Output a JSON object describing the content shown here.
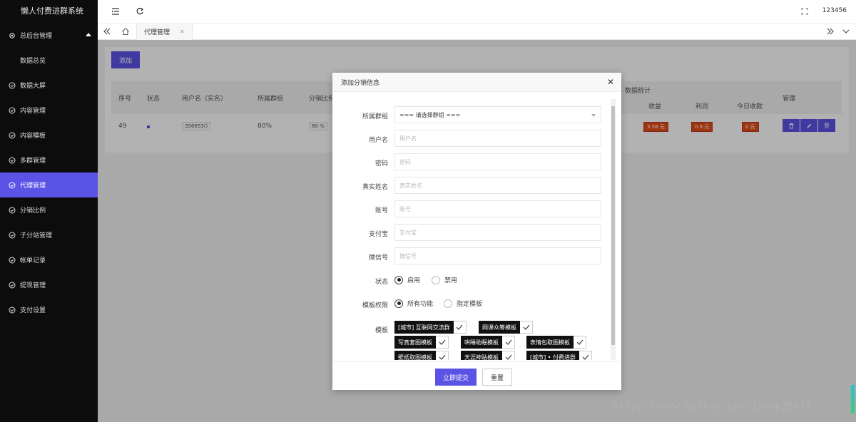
{
  "app": {
    "title": "懒人付费进群系统",
    "user": "123456"
  },
  "sidebar": {
    "items": [
      {
        "label": "总后台管理",
        "expanded": true
      },
      {
        "label": "数据总览",
        "sub": true
      },
      {
        "label": "数据大屏"
      },
      {
        "label": "内容管理"
      },
      {
        "label": "内容模板"
      },
      {
        "label": "多群管理"
      },
      {
        "label": "代理管理",
        "active": true
      },
      {
        "label": "分销比例"
      },
      {
        "label": "子分站管理"
      },
      {
        "label": "帐单记录"
      },
      {
        "label": "提现管理"
      },
      {
        "label": "支付设置"
      }
    ]
  },
  "tabs": {
    "active": "代理管理"
  },
  "page": {
    "add_label": "添加",
    "table": {
      "headers": {
        "index": "序号",
        "status": "状态",
        "username": "用户名（实名）",
        "group": "所属群组",
        "ratio": "分销比例",
        "stats": "数据统计",
        "income": "收益",
        "profit": "利润",
        "today": "今日收款",
        "manage": "管理"
      },
      "row": {
        "index": "49",
        "username": "356653()",
        "group": "80%",
        "ratio": "80 %",
        "income": "3.58 元",
        "profit": "0.9 元",
        "today": "0 元"
      },
      "ops": [
        "删",
        "编",
        "登"
      ]
    }
  },
  "modal": {
    "title": "添加分销信息",
    "fields": {
      "group": {
        "label": "所属群组",
        "value": "=== 请选择群组 ==="
      },
      "username": {
        "label": "用户名",
        "placeholder": "用户名"
      },
      "password": {
        "label": "密码",
        "placeholder": "密码"
      },
      "realname": {
        "label": "真实姓名",
        "placeholder": "真实姓名"
      },
      "account": {
        "label": "账号",
        "placeholder": "账号"
      },
      "alipay": {
        "label": "支付宝",
        "placeholder": "支付宝"
      },
      "wechat": {
        "label": "微信号",
        "placeholder": "微信号"
      }
    },
    "status": {
      "label": "状态",
      "options": [
        "启用",
        "禁用"
      ],
      "selected": "启用"
    },
    "permission": {
      "label": "模板权限",
      "options": [
        "所有功能",
        "指定模板"
      ],
      "selected": "所有功能"
    },
    "templates": {
      "label": "模板",
      "items": [
        "[城市] 互联网交流群",
        "网课众筹模板",
        "写真套图模板",
        "哄睡助眠模板",
        "表情包取图模板",
        "壁纸取图模板",
        "天涯神贴模板",
        "[城市] • 付费进群"
      ]
    },
    "submit_label": "立即提交",
    "reset_label": "重置"
  },
  "watermark": "https://www.huzhan.com/ishop26473",
  "colors": {
    "accent": "#5b52e6",
    "sidebar": "#0c0c0c",
    "money": "#e34c14"
  }
}
